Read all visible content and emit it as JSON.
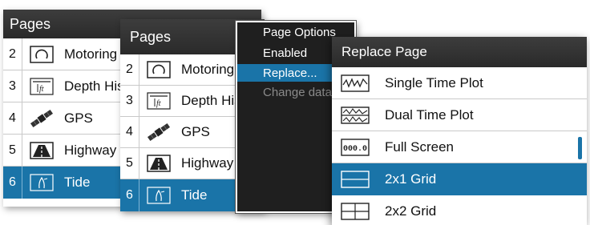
{
  "panel1": {
    "title": "Pages",
    "rows": [
      {
        "num": "2",
        "label": "Motoring",
        "icon": "motoring-icon"
      },
      {
        "num": "3",
        "label": "Depth History",
        "icon": "depth-history-icon"
      },
      {
        "num": "4",
        "label": "GPS",
        "icon": "gps-satellite-icon"
      },
      {
        "num": "5",
        "label": "Highway",
        "icon": "highway-icon"
      },
      {
        "num": "6",
        "label": "Tide",
        "icon": "tide-icon"
      }
    ],
    "selected_row": "6"
  },
  "panel2": {
    "title": "Pages",
    "rows": [
      {
        "num": "2",
        "label": "Motoring",
        "icon": "motoring-icon"
      },
      {
        "num": "3",
        "label": "Depth History",
        "icon": "depth-history-icon"
      },
      {
        "num": "4",
        "label": "GPS",
        "icon": "gps-satellite-icon"
      },
      {
        "num": "5",
        "label": "Highway",
        "icon": "highway-icon"
      },
      {
        "num": "6",
        "label": "Tide",
        "icon": "tide-icon"
      }
    ],
    "selected_row": "6"
  },
  "page_options": {
    "title": "Page Options",
    "items": [
      {
        "label": "Enabled",
        "state": "normal"
      },
      {
        "label": "Replace...",
        "state": "selected"
      },
      {
        "label": "Change data",
        "state": "disabled"
      }
    ]
  },
  "replace_page": {
    "title": "Replace Page",
    "items": [
      {
        "label": "Single Time Plot",
        "icon": "single-time-plot-icon"
      },
      {
        "label": "Dual Time Plot",
        "icon": "dual-time-plot-icon"
      },
      {
        "label": "Full Screen",
        "icon": "full-screen-icon",
        "icon_text": "000.0"
      },
      {
        "label": "2x1 Grid",
        "icon": "grid-2x1-icon"
      },
      {
        "label": "2x2 Grid",
        "icon": "grid-2x2-icon"
      }
    ],
    "selected_item": "2x1 Grid"
  },
  "colors": {
    "header": "#2f2f2f",
    "accent": "#1a74a8",
    "row_divider": "#c9c9c9"
  }
}
